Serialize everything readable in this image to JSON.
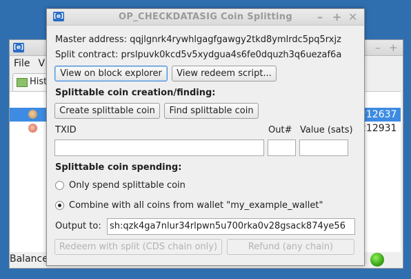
{
  "background_window": {
    "menu": [
      "File",
      "V"
    ],
    "tab_label": "Hist",
    "rows": [
      {
        "value": "212637",
        "selected": true
      },
      {
        "value": "212931",
        "selected": false
      }
    ],
    "status_label": "Balance"
  },
  "dialog": {
    "title": "OP_CHECKDATASIG Coin Splitting",
    "master_address": "Master address: qqjlgnrk4rywhlgagfgawgy2tkd8ymlrdc5pq5rxjz",
    "split_contract": "Split contract: prslpuvk0kcd5v5xydgua4s6fe0dquzh3q6uezaf6a",
    "view_explorer_label": "View on block explorer",
    "view_redeem_label": "View redeem script...",
    "creation_heading": "Splittable coin creation/finding:",
    "create_button": "Create splittable coin",
    "find_button": "Find splittable coin",
    "txid_label": "TXID",
    "out_label": "Out#",
    "value_label": "Value (sats)",
    "txid_value": "",
    "out_value": "",
    "value_value": "",
    "spending_heading": "Splittable coin spending:",
    "radio_only": "Only spend splittable coin",
    "radio_combine": "Combine with all coins from wallet \"my_example_wallet\"",
    "radio_selected": "combine",
    "output_label": "Output to:",
    "output_value": "sh:qzk4ga7nlur34rlpwn5u700rka0v28gsack874ye56",
    "redeem_button": "Redeem with split (CDS chain only)",
    "refund_button": "Refund (any chain)"
  }
}
